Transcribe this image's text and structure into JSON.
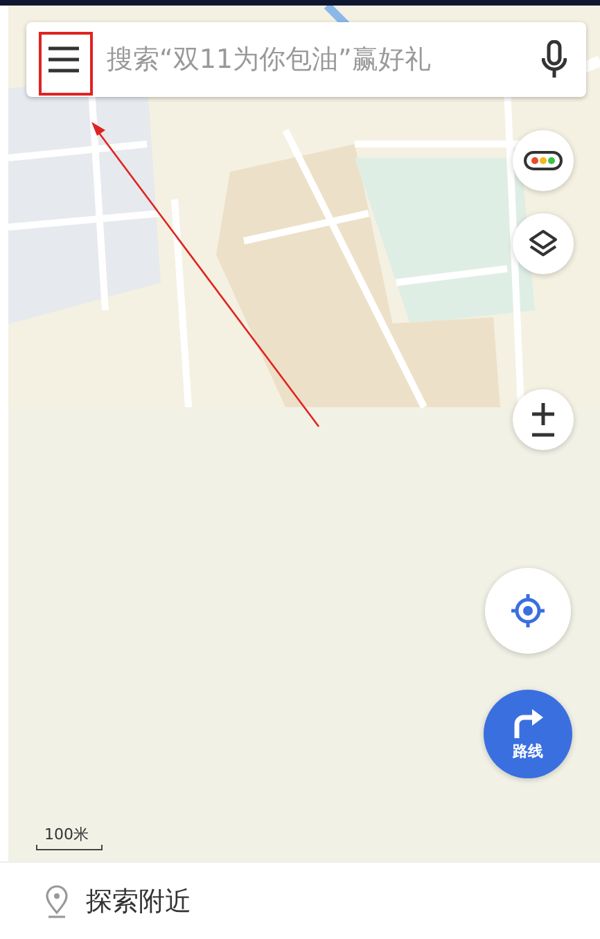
{
  "search": {
    "placeholder": "搜索“双11为你包油”赢好礼"
  },
  "map": {
    "kind": "picture",
    "scale_label": "100米"
  },
  "route_button": {
    "label": "路线"
  },
  "bottom_bar": {
    "label": "探索附近"
  }
}
